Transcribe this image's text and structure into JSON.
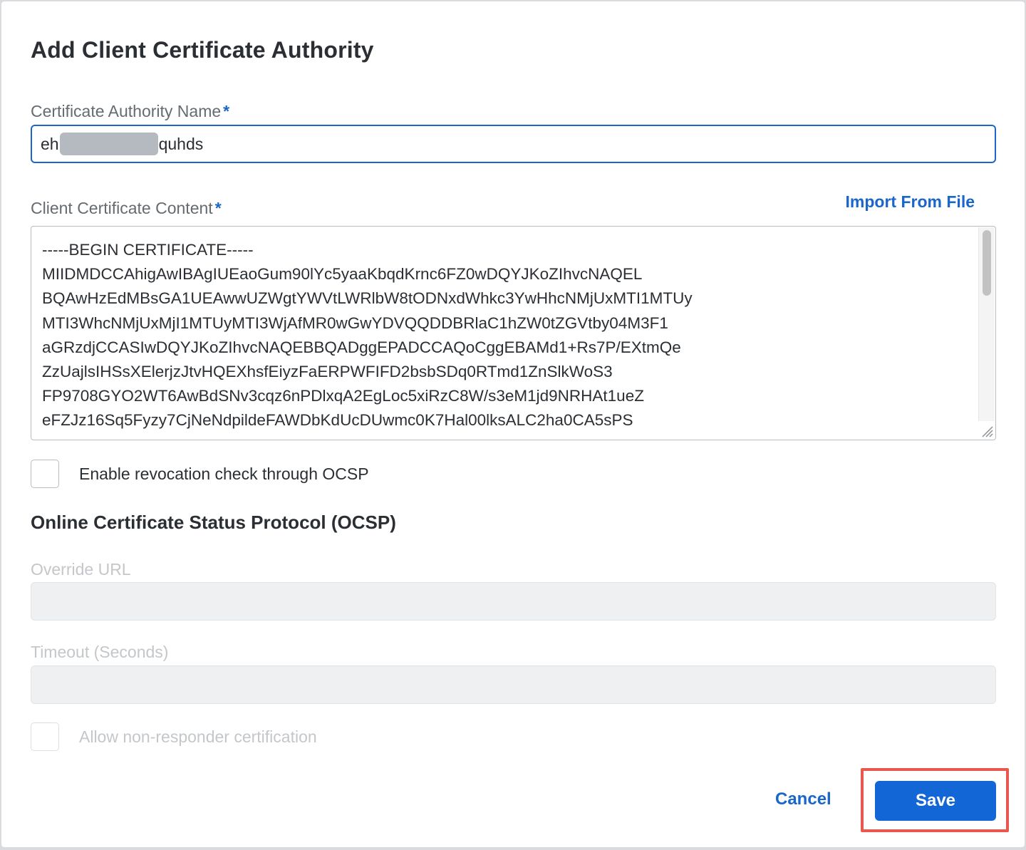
{
  "dialog": {
    "title": "Add Client Certificate Authority"
  },
  "ca_name": {
    "label": "Certificate Authority Name",
    "required_mark": "*",
    "value_prefix": "eh",
    "value_suffix": "quhds"
  },
  "cert_content": {
    "label": "Client Certificate Content",
    "required_mark": "*",
    "import_link": "Import From File",
    "lines": [
      "-----BEGIN CERTIFICATE-----",
      "MIIDMDCCAhigAwIBAgIUEaoGum90lYc5yaaKbqdKrnc6FZ0wDQYJKoZIhvcNAQEL",
      "BQAwHzEdMBsGA1UEAwwUZWgtYWVtLWRlbW8tODNxdWhkc3YwHhcNMjUxMTI1MTUy",
      "MTI3WhcNMjUxMjI1MTUyMTI3WjAfMR0wGwYDVQQDDBRlaC1hZW0tZGVtby04M3F1",
      "aGRzdjCCASIwDQYJKoZIhvcNAQEBBQADggEPADCCAQoCggEBAMd1+Rs7P/EXtmQe",
      "ZzUajlsIHSsXElerjzJtvHQEXhsfEiyzFaERPWFIFD2bsbSDq0RTmd1ZnSlkWoS3",
      "FP9708GYO2WT6AwBdSNv3cqz6nPDlxqA2EgLoc5xiRzC8W/s3eM1jd9NRHAt1ueZ",
      "eFZJz16Sq5Fyzy7CjNeNdpildeFAWDbKdUcDUwmc0K7Hal00lksALC2ha0CA5sPS"
    ]
  },
  "ocsp_check": {
    "label": "Enable revocation check through OCSP",
    "checked": false
  },
  "ocsp_section": {
    "title": "Online Certificate Status Protocol (OCSP)",
    "override_url_label": "Override URL",
    "override_url_value": "",
    "timeout_label": "Timeout (Seconds)",
    "timeout_value": "",
    "non_responder_label": "Allow non-responder certification",
    "non_responder_checked": false
  },
  "footer": {
    "cancel_label": "Cancel",
    "save_label": "Save"
  },
  "colors": {
    "accent": "#1a66c9",
    "save_button": "#1366d6",
    "highlight_box": "#e9574e"
  }
}
